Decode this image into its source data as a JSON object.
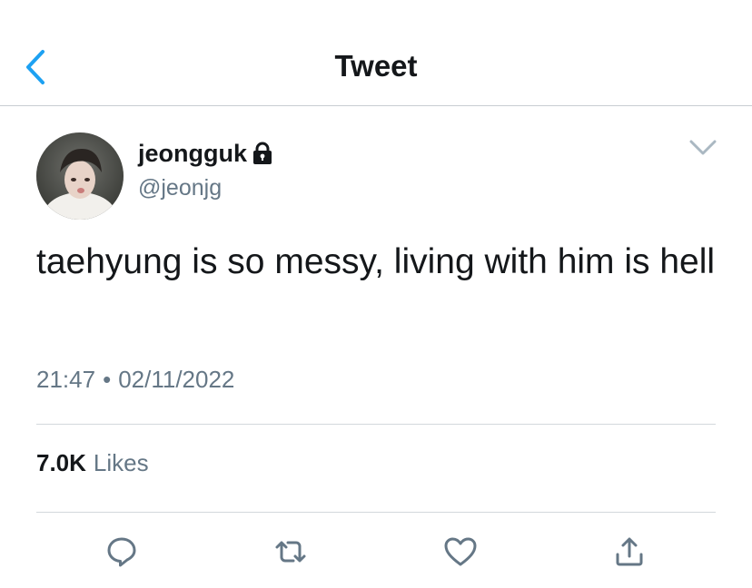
{
  "header": {
    "title": "Tweet",
    "back_icon": "chevron-left-icon",
    "accent_color": "#1da1f2"
  },
  "author": {
    "display_name": "jeongguk",
    "handle": "@jeonjg",
    "protected_icon": "lock-icon"
  },
  "tweet": {
    "text": "taehyung is so messy, living with him is hell",
    "time": "21:47",
    "separator": "•",
    "date": "02/11/2022"
  },
  "stats": {
    "likes_count": "7.0K",
    "likes_label": "Likes"
  },
  "actions": {
    "reply_icon": "reply-icon",
    "retweet_icon": "retweet-icon",
    "like_icon": "heart-icon",
    "share_icon": "share-icon",
    "icon_color": "#657786"
  }
}
